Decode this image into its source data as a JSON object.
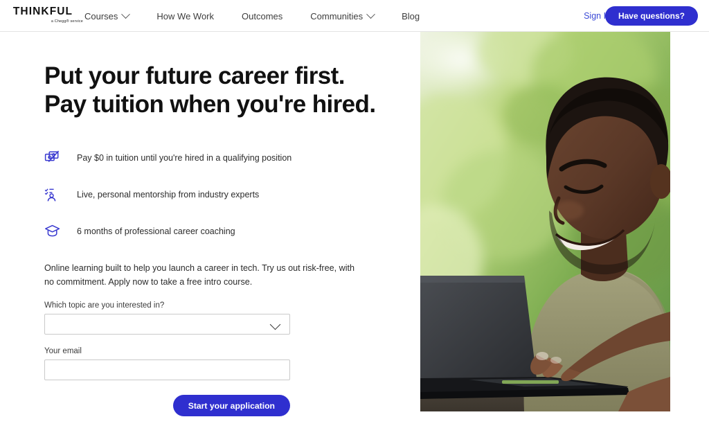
{
  "brand": {
    "accent": "#2f2fcf",
    "link": "#3b4ad6",
    "logo_name": "THINKFUL",
    "logo_tagline": "a Chegg® service"
  },
  "header": {
    "nav": [
      {
        "label": "Courses",
        "has_caret": true,
        "icon": "chevron-down-icon"
      },
      {
        "label": "How We Work",
        "has_caret": false,
        "icon": ""
      },
      {
        "label": "Outcomes",
        "has_caret": false,
        "icon": ""
      },
      {
        "label": "Communities",
        "has_caret": true,
        "icon": "chevron-down-icon"
      },
      {
        "label": "Blog",
        "has_caret": false,
        "icon": ""
      }
    ],
    "sign_in_label": "Sign In",
    "cta_label": "Have questions?"
  },
  "hero": {
    "headline_line1": "Put your future career first.",
    "headline_line2": "Pay tuition when you're hired.",
    "features": [
      {
        "icon": "no-money-icon",
        "text": "Pay $0 in tuition until you're hired in a qualifying position"
      },
      {
        "icon": "mentor-person-checklist-icon",
        "text": "Live, personal mentorship from industry experts"
      },
      {
        "icon": "graduation-cap-icon",
        "text": "6 months of professional career coaching"
      }
    ],
    "blurb": "Online learning built to help you launch a career in tech. Try us out risk-free, with no commitment. Apply now to take a free intro course."
  },
  "form": {
    "topic_label": "Which topic are you interested in?",
    "topic_value": "",
    "topic_placeholder": "",
    "topic_caret_icon": "chevron-down-icon",
    "email_label": "Your email",
    "email_value": "",
    "email_placeholder": "",
    "submit_label": "Start your application"
  },
  "photo": {
    "alt": "Smiling man working on a laptop outdoors with green foliage behind him"
  }
}
